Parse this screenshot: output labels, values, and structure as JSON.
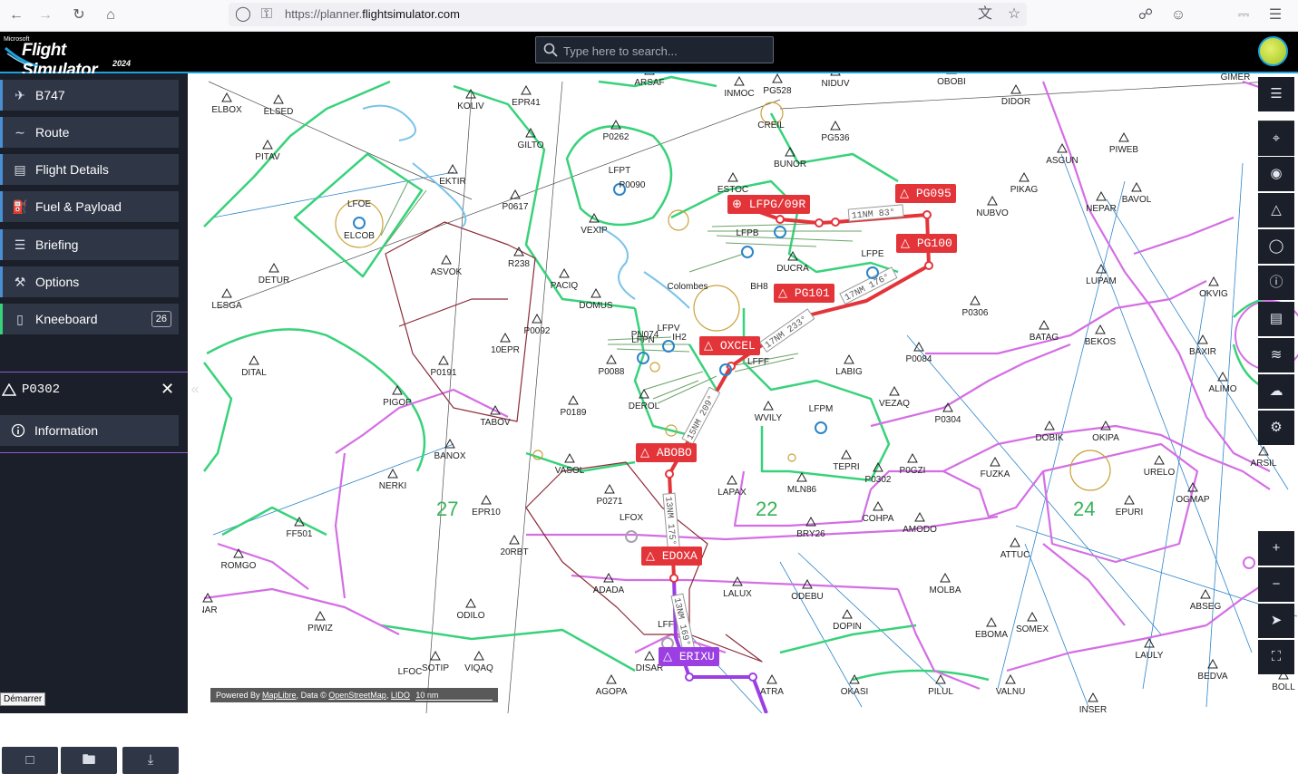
{
  "browser": {
    "url_prefix": "https://planner.",
    "url_domain": "flightsimulator.com",
    "icons": [
      "back-icon",
      "forward-icon",
      "reload-icon",
      "home-icon",
      "shield-icon",
      "lock-icon",
      "translate-icon",
      "star-icon",
      "pocket-icon",
      "account-icon",
      "extensions-icon",
      "menu-icon"
    ]
  },
  "header": {
    "logo_top": "Microsoft",
    "logo_main": "Flight Simulator",
    "logo_year": "2024",
    "search_placeholder": "Type here to search..."
  },
  "sidebar": {
    "items": [
      {
        "label": "B747",
        "icon": "plane-icon"
      },
      {
        "label": "Route",
        "icon": "route-icon"
      },
      {
        "label": "Flight Details",
        "icon": "clipboard-icon"
      },
      {
        "label": "Fuel & Payload",
        "icon": "fuel-icon"
      },
      {
        "label": "Briefing",
        "icon": "document-icon"
      },
      {
        "label": "Options",
        "icon": "wrench-icon"
      },
      {
        "label": "Kneeboard",
        "icon": "kneeboard-icon",
        "badge": "26"
      }
    ],
    "waypoint": {
      "title": "P0302",
      "info_label": "Information"
    },
    "tooltip": "Démarrer"
  },
  "map": {
    "route_labels": [
      {
        "id": "LFPG/09R",
        "color": "red"
      },
      {
        "id": "PG095",
        "color": "red"
      },
      {
        "id": "PG100",
        "color": "red"
      },
      {
        "id": "PG101",
        "color": "red"
      },
      {
        "id": "OXCEL",
        "color": "red"
      },
      {
        "id": "ABOBO",
        "color": "red"
      },
      {
        "id": "EDOXA",
        "color": "red"
      },
      {
        "id": "ERIXU",
        "color": "purple"
      }
    ],
    "leg_labels": [
      "11NM 83°",
      "17NM 176°",
      "17NM 233°",
      "15NM 209°",
      "13NM 175°",
      "13NM 169°"
    ],
    "sector_numbers": [
      "27",
      "22",
      "24"
    ],
    "airports": [
      "LFOE",
      "ELCOB",
      "LFPT",
      "P0090",
      "LFPB",
      "LFPE",
      "LFPV",
      "LFPN",
      "LFFF",
      "LFPM",
      "LFOX",
      "LFF",
      "LFOC"
    ],
    "points": [
      "ELBOX",
      "ELSED",
      "KOLIV",
      "EPR41",
      "ARSAF",
      "INMOC",
      "PG528",
      "CREIL",
      "NIDUV",
      "OBOBI",
      "DIDOR",
      "GIMER",
      "PITAV",
      "GILTO",
      "P0262",
      "BUNOR",
      "PG536",
      "ASGUN",
      "PIWEB",
      "EKTIR",
      "P0617",
      "ESTOC",
      "NUBVO",
      "PIKAG",
      "NEPAR",
      "BAVOL",
      "DETUR",
      "ASVOK",
      "R238",
      "PACIQ",
      "DOMUS",
      "VEXIP",
      "BH8",
      "DUCRA",
      "Colombes",
      "LUPAM",
      "OKVIG",
      "LESGA",
      "P0092",
      "10EPR",
      "PN074",
      "IH2",
      "P0306",
      "BATAG",
      "BEKOS",
      "BAXIR",
      "DITAL",
      "P0191",
      "P0088",
      "LABIG",
      "P0084",
      "ALIMO",
      "PIGOP",
      "TABOV",
      "P0189",
      "DEROL",
      "WVILY",
      "VEZAQ",
      "P0304",
      "DOBIK",
      "OKIPA",
      "BANOX",
      "VASOL",
      "TEPRI",
      "P0GZI",
      "FUZKA",
      "URELO",
      "ARSIL",
      "NERKI",
      "P0271",
      "LAPAX",
      "MLN86",
      "P0302",
      "EPURI",
      "OGMAP",
      "EPR10",
      "FF501",
      "20RBT",
      "BRY26",
      "COHPA",
      "AMODO",
      "ROMGO",
      "ATTUC",
      "ADADA",
      "LALUX",
      "ODEBU",
      "MOLBA",
      "ABSEG",
      "ODILO",
      "PIWIZ",
      "NAR",
      "DOPIN",
      "EBOMA",
      "SOMEX",
      "LAULY",
      "SOTIP",
      "VIQAQ",
      "DISAR",
      "AGOPA",
      "ATRA",
      "OKASI",
      "PILUL",
      "VALNU",
      "BEDVA",
      "BOLL",
      "INSER"
    ],
    "attribution": {
      "powered": "Powered By",
      "maplibre": "MapLibre",
      "data": "Data ©",
      "osm": "OpenStreetMap",
      "lido": "LIDO",
      "scale": "10 nm"
    }
  },
  "colors": {
    "accent": "#1ba3e0",
    "route_red": "#e3343a",
    "route_purple": "#9b3fe3",
    "airspace_green": "#38d27a",
    "airspace_magenta": "#d46ee4",
    "airspace_dark_red": "#8b2c3a",
    "sidebar_bg": "#1b1f29",
    "sidebar_item_bg": "#2f3646"
  },
  "toolbar": {
    "icons": [
      "layers-icon",
      "crosshair-icon",
      "target-icon",
      "triangle-waypoint-icon",
      "circle-vor-icon",
      "info-circle-icon",
      "ruler-icon",
      "wind-icon",
      "weather-icon",
      "settings-icon"
    ],
    "zoom_in": "+",
    "zoom_out": "−",
    "bottom_icons": [
      "locate-icon",
      "fullscreen-icon"
    ]
  }
}
